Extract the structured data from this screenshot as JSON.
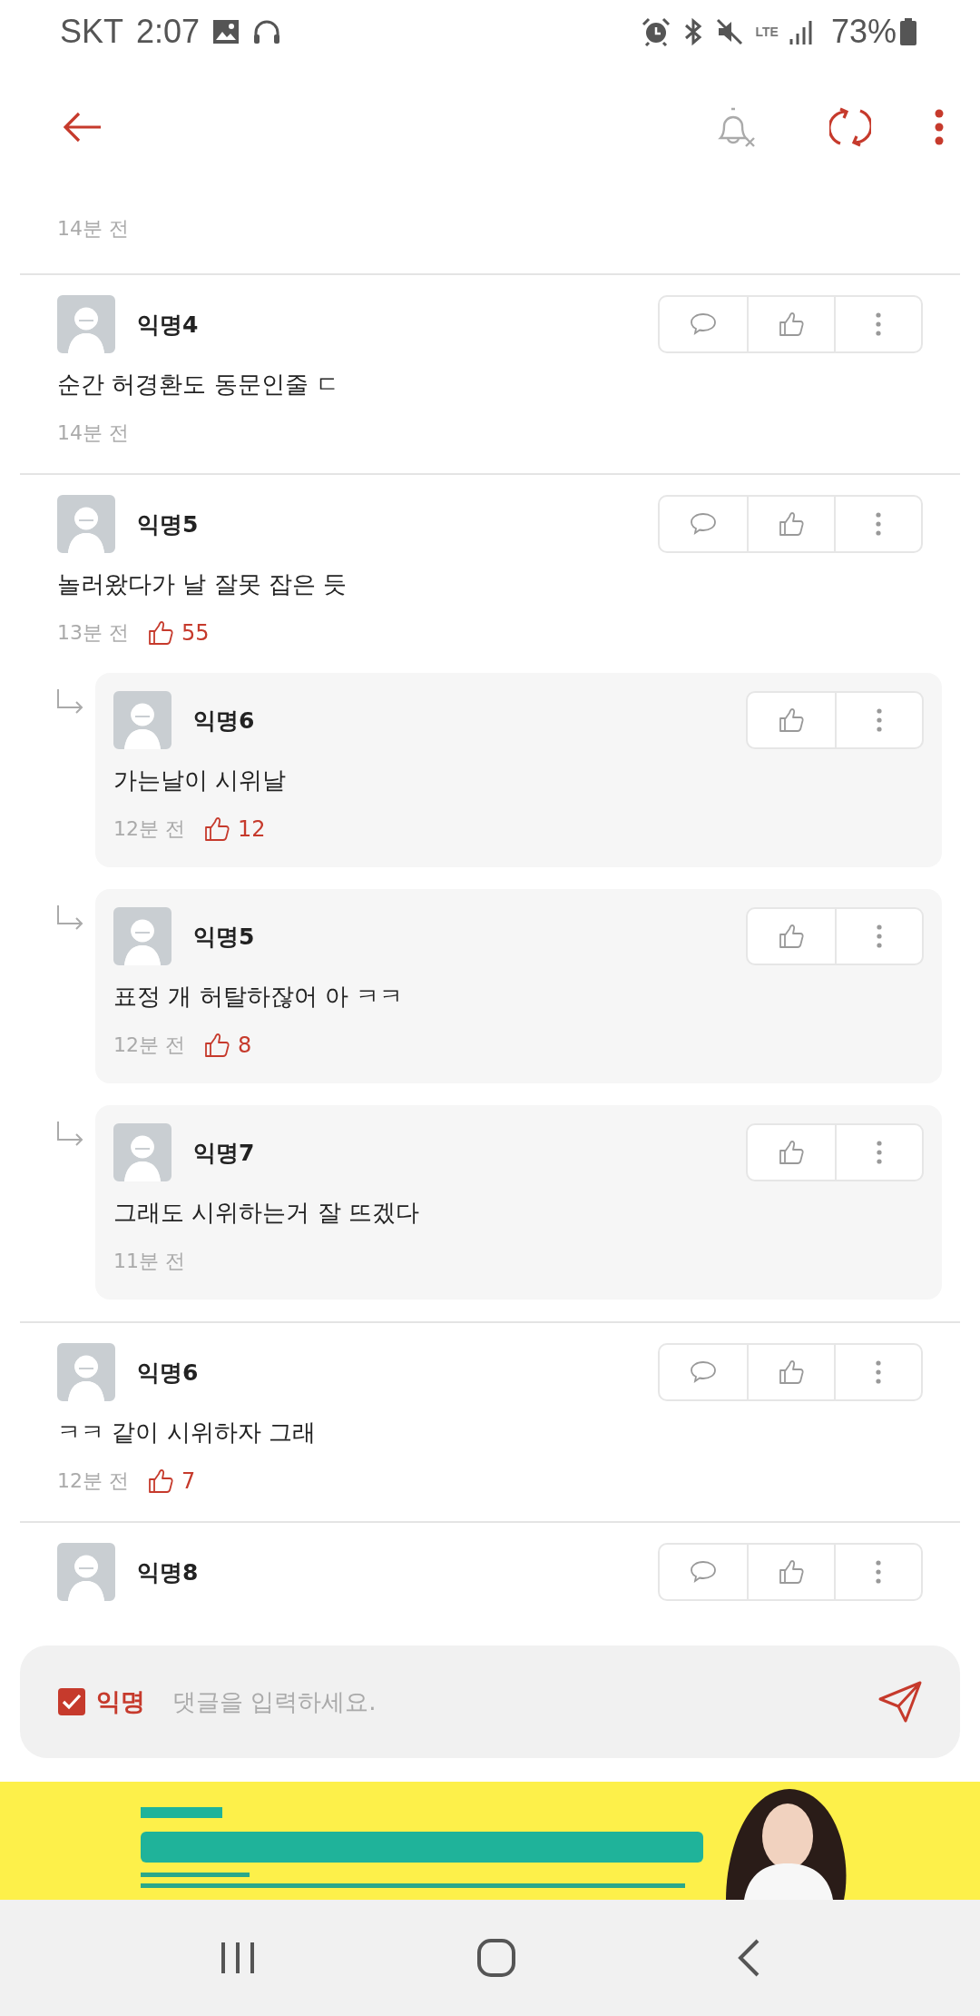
{
  "status_bar": {
    "carrier": "SKT",
    "time": "2:07",
    "network": "LTE",
    "battery": "73%"
  },
  "top_time": "14분 전",
  "comments": [
    {
      "author": "익명4",
      "text": "순간 허경환도 동문인줄 ㄷ",
      "time": "14분 전"
    },
    {
      "author": "익명5",
      "text": "놀러왔다가 날 잘못 잡은 듯",
      "time": "13분 전",
      "likes": "55",
      "replies": [
        {
          "author": "익명6",
          "text": "가는날이 시위날",
          "time": "12분 전",
          "likes": "12"
        },
        {
          "author": "익명5",
          "text": "표정 개 허탈하잖어 아 ㅋㅋ",
          "time": "12분 전",
          "likes": "8"
        },
        {
          "author": "익명7",
          "text": "그래도 시위하는거 잘 뜨겠다",
          "time": "11분 전"
        }
      ]
    },
    {
      "author": "익명6",
      "text": "ㅋㅋ 같이 시위하자 그래",
      "time": "12분 전",
      "likes": "7"
    },
    {
      "author": "익명8"
    }
  ],
  "composer": {
    "anonymous": {
      "label": "익명",
      "checked": true
    },
    "placeholder": "댓글을 입력하세요."
  }
}
